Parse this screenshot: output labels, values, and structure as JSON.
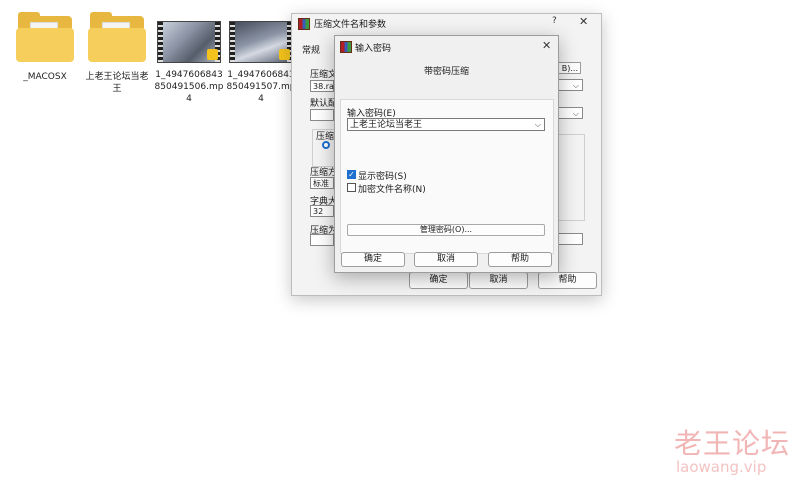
{
  "desktop": {
    "items": [
      {
        "label": "_MACOSX",
        "type": "folder"
      },
      {
        "label": "上老王论坛当老王",
        "type": "folder"
      },
      {
        "label": "1_4947606843850491506.mp4",
        "type": "video"
      },
      {
        "label": "1_4947606843850491507.mp4",
        "type": "video"
      }
    ]
  },
  "archive_dialog": {
    "title": "压缩文件名和参数",
    "help_label": "?",
    "close_label": "✕",
    "tab_general": "常规",
    "fragments": {
      "archive_name": "压缩文",
      "archive_name_value": "38.ra",
      "default_profile": "默认配",
      "format": "压缩",
      "method": "压缩方",
      "method_value": "标准",
      "dict_size": "字典大",
      "dict_value": "32",
      "split": "压缩为",
      "browse_partial": "B)..."
    },
    "buttons": {
      "ok": "确定",
      "cancel": "取消",
      "help": "帮助"
    }
  },
  "password_dialog": {
    "title": "输入密码",
    "close_label": "✕",
    "heading": "带密码压缩",
    "field_label": "输入密码(E)",
    "password_value": "上老王论坛当老王",
    "show_password_label": "显示密码(S)",
    "show_password_checked": true,
    "encrypt_names_label": "加密文件名称(N)",
    "encrypt_names_checked": false,
    "manage_button": "管理密码(O)...",
    "buttons": {
      "ok": "确定",
      "cancel": "取消",
      "help": "帮助"
    }
  },
  "watermark": {
    "text": "老王论坛",
    "url": "laowang.vip"
  },
  "colors": {
    "accent": "#1f6fd1",
    "folder": "#f6ce5c",
    "watermark": "#f2b5b5"
  }
}
